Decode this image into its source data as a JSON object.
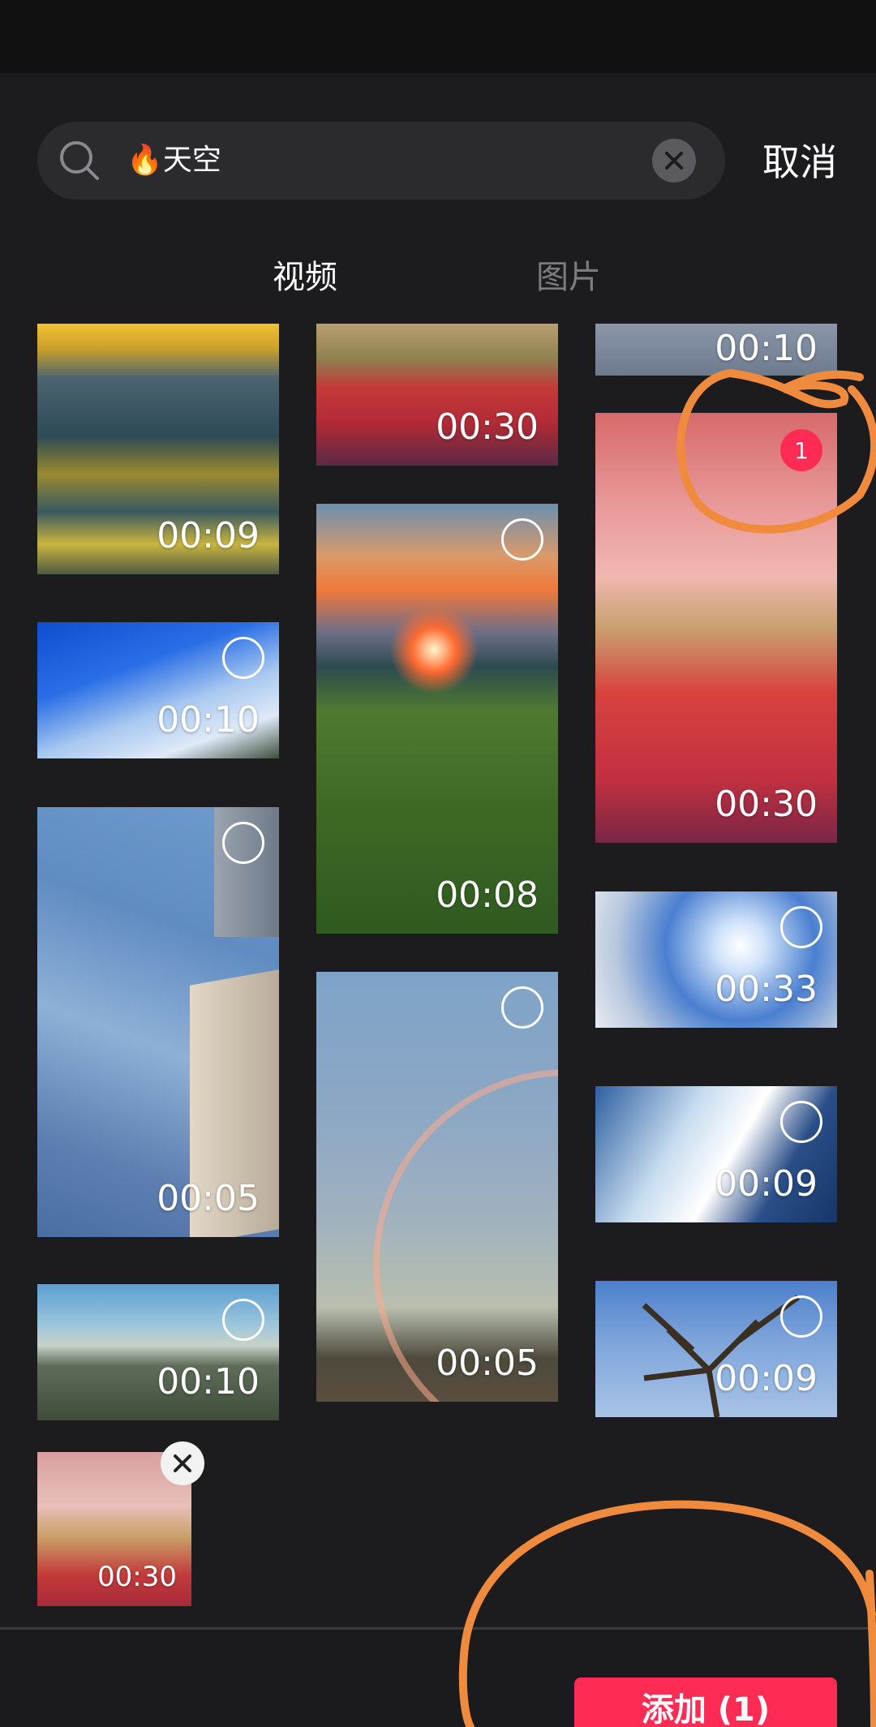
{
  "search": {
    "query": "🔥天空"
  },
  "cancel_label": "取消",
  "tabs": [
    {
      "label": "视频",
      "active": true
    },
    {
      "label": "图片",
      "active": false
    }
  ],
  "grid": {
    "col1": [
      {
        "duration": "00:09",
        "scene": "sunset lake reflection"
      },
      {
        "duration": "00:10",
        "scene": "blue sky clouds"
      },
      {
        "duration": "00:05",
        "scene": "building and sky"
      },
      {
        "duration": "00:10",
        "scene": "city river bridge"
      }
    ],
    "col2": [
      {
        "duration": "00:30",
        "scene": "red running track"
      },
      {
        "duration": "00:08",
        "scene": "sunset flower field"
      },
      {
        "duration": "00:05",
        "scene": "rainbow sky"
      }
    ],
    "col3": [
      {
        "duration": "00:10",
        "scene": "grey sky"
      },
      {
        "duration": "00:30",
        "scene": "pink sky running track",
        "selected_index": "1"
      },
      {
        "duration": "00:33",
        "scene": "sun and clouds"
      },
      {
        "duration": "00:09",
        "scene": "skyscrapers"
      },
      {
        "duration": "00:09",
        "scene": "tree branches sky"
      }
    ]
  },
  "selected_tray": [
    {
      "duration": "00:30",
      "scene": "pink sky running track"
    }
  ],
  "add_button_label": "添加 (1)",
  "colors": {
    "accent": "#fe2c55",
    "background": "#1c1b1d",
    "annotation": "#f08a3c"
  }
}
